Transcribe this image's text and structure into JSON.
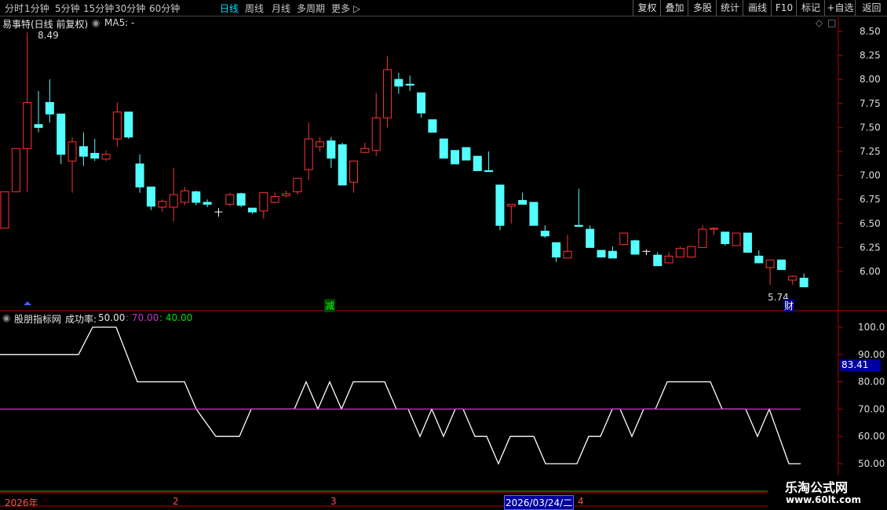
{
  "toolbar": {
    "left_items": [
      {
        "label": "分时",
        "active": false
      },
      {
        "label": "1分钟",
        "active": false
      },
      {
        "label": "5分钟",
        "active": false
      },
      {
        "label": "15分钟",
        "active": false
      },
      {
        "label": "30分钟",
        "active": false
      },
      {
        "label": "60分钟",
        "active": false
      },
      {
        "label": "日线",
        "active": true
      },
      {
        "label": "周线",
        "active": false
      },
      {
        "label": "月线",
        "active": false
      },
      {
        "label": "多周期",
        "active": false
      },
      {
        "label": "更多",
        "active": false
      }
    ],
    "right_items": [
      "复权",
      "叠加",
      "多股",
      "统计",
      "画线",
      "F10",
      "标记",
      "+自选",
      "返回"
    ]
  },
  "main_panel": {
    "title": "易事特(日线 前复权)",
    "ma_label": "MA5: -",
    "high_label": "8.49",
    "low_label": "5.74",
    "marker_jian": "减",
    "marker_cai": "财",
    "price_ticks": [
      "8.50",
      "8.25",
      "8.00",
      "7.75",
      "7.50",
      "7.25",
      "7.00",
      "6.75",
      "6.50",
      "6.25",
      "6.00"
    ]
  },
  "sub_panel": {
    "indicator_name": "股朋指标网",
    "field_label": "成功率:",
    "value": "50.00",
    "value2": "70.00",
    "value3": "40.00",
    "current_tag": "83.41",
    "ticks": [
      "100.0",
      "90.00",
      "80.00",
      "70.00",
      "60.00",
      "50.00"
    ]
  },
  "date_axis": {
    "year_label": "2026年",
    "month_labels": [
      "2",
      "3",
      "4"
    ],
    "cursor_date": "2026/03/24/二"
  },
  "watermark": {
    "title": "乐淘公式网",
    "url": "www.60lt.com"
  },
  "colors": {
    "up": "#ff3232",
    "down": "#54ffff",
    "cross": "#ffffff",
    "line_purple": "#c832c8",
    "axis": "#b40000"
  },
  "chart_data": [
    {
      "type": "candlestick",
      "title": "易事特(日线 前复权)",
      "ylim": [
        5.72,
        8.58
      ],
      "candles": [
        [
          6.45,
          6.83,
          6.83,
          6.45
        ],
        [
          6.83,
          7.28,
          7.28,
          6.83
        ],
        [
          7.28,
          7.76,
          8.49,
          6.83
        ],
        [
          7.53,
          7.5,
          7.88,
          7.45
        ],
        [
          7.76,
          7.64,
          8.0,
          7.55
        ],
        [
          7.64,
          7.22,
          7.64,
          7.12
        ],
        [
          7.15,
          7.35,
          7.4,
          6.82
        ],
        [
          7.3,
          7.2,
          7.45,
          7.1
        ],
        [
          7.23,
          7.18,
          7.38,
          7.15
        ],
        [
          7.17,
          7.22,
          7.26,
          7.15
        ],
        [
          7.38,
          7.66,
          7.76,
          7.3
        ],
        [
          7.66,
          7.4,
          7.66,
          7.38
        ],
        [
          7.12,
          6.88,
          7.22,
          6.82
        ],
        [
          6.88,
          6.68,
          6.88,
          6.64
        ],
        [
          6.67,
          6.73,
          6.75,
          6.62
        ],
        [
          6.67,
          6.8,
          7.08,
          6.52
        ],
        [
          6.72,
          6.84,
          6.88,
          6.69
        ],
        [
          6.83,
          6.72,
          6.84,
          6.69
        ],
        [
          6.72,
          6.7,
          6.75,
          6.67
        ],
        [
          6.62,
          6.62,
          6.66,
          6.57
        ],
        [
          6.7,
          6.8,
          6.82,
          6.68
        ],
        [
          6.81,
          6.69,
          6.82,
          6.67
        ],
        [
          6.66,
          6.62,
          6.66,
          6.6
        ],
        [
          6.63,
          6.82,
          6.82,
          6.55
        ],
        [
          6.72,
          6.78,
          6.82,
          6.71
        ],
        [
          6.79,
          6.81,
          6.84,
          6.77
        ],
        [
          6.83,
          6.97,
          6.97,
          6.8
        ],
        [
          7.06,
          7.38,
          7.55,
          6.95
        ],
        [
          7.3,
          7.35,
          7.4,
          7.25
        ],
        [
          7.36,
          7.18,
          7.4,
          7.08
        ],
        [
          7.32,
          6.9,
          7.34,
          6.9
        ],
        [
          6.93,
          7.15,
          7.15,
          6.82
        ],
        [
          7.24,
          7.28,
          7.34,
          7.23
        ],
        [
          7.26,
          7.6,
          7.86,
          7.2
        ],
        [
          7.6,
          8.1,
          8.24,
          7.5
        ],
        [
          8.0,
          7.93,
          8.07,
          7.85
        ],
        [
          7.95,
          7.94,
          8.04,
          7.88
        ],
        [
          7.86,
          7.65,
          7.86,
          7.6
        ],
        [
          7.58,
          7.45,
          7.58,
          7.45
        ],
        [
          7.38,
          7.18,
          7.38,
          7.18
        ],
        [
          7.26,
          7.12,
          7.26,
          7.12
        ],
        [
          7.29,
          7.16,
          7.29,
          7.16
        ],
        [
          7.2,
          7.05,
          7.2,
          7.05
        ],
        [
          7.05,
          7.04,
          7.25,
          7.04
        ],
        [
          6.9,
          6.48,
          6.9,
          6.43
        ],
        [
          6.68,
          6.7,
          6.7,
          6.5
        ],
        [
          6.74,
          6.7,
          6.82,
          6.7
        ],
        [
          6.72,
          6.48,
          6.72,
          6.48
        ],
        [
          6.42,
          6.37,
          6.48,
          6.35
        ],
        [
          6.3,
          6.15,
          6.3,
          6.1
        ],
        [
          6.14,
          6.21,
          6.38,
          6.14
        ],
        [
          6.48,
          6.47,
          6.86,
          6.47
        ],
        [
          6.44,
          6.25,
          6.48,
          6.25
        ],
        [
          6.22,
          6.15,
          6.22,
          6.15
        ],
        [
          6.21,
          6.14,
          6.26,
          6.14
        ],
        [
          6.28,
          6.4,
          6.4,
          6.27
        ],
        [
          6.32,
          6.18,
          6.33,
          6.18
        ],
        [
          6.21,
          6.21,
          6.23,
          6.17
        ],
        [
          6.17,
          6.06,
          6.2,
          6.06
        ],
        [
          6.09,
          6.16,
          6.2,
          6.09
        ],
        [
          6.15,
          6.24,
          6.26,
          6.15
        ],
        [
          6.15,
          6.26,
          6.26,
          6.14
        ],
        [
          6.25,
          6.44,
          6.48,
          6.25
        ],
        [
          6.44,
          6.45,
          6.46,
          6.38
        ],
        [
          6.41,
          6.29,
          6.41,
          6.27
        ],
        [
          6.27,
          6.4,
          6.4,
          6.27
        ],
        [
          6.4,
          6.2,
          6.4,
          6.2
        ],
        [
          6.16,
          6.09,
          6.22,
          6.09
        ],
        [
          6.04,
          6.12,
          6.12,
          5.86
        ],
        [
          6.12,
          6.02,
          6.12,
          6.02
        ],
        [
          5.91,
          5.95,
          5.96,
          5.86
        ],
        [
          5.93,
          5.84,
          5.98,
          5.84
        ]
      ]
    },
    {
      "type": "line",
      "title": "股朋指标网 成功率",
      "ylim": [
        47.5,
        102.5
      ],
      "series": [
        {
          "name": "成功率",
          "values": [
            [
              0,
              90
            ],
            [
              100,
              90
            ],
            [
              118,
              100
            ],
            [
              148,
              100
            ],
            [
              175,
              80
            ],
            [
              235,
              80
            ],
            [
              250,
              70
            ],
            [
              275,
              60
            ],
            [
              305,
              60
            ],
            [
              320,
              70
            ],
            [
              375,
              70
            ],
            [
              390,
              80
            ],
            [
              405,
              70
            ],
            [
              420,
              80
            ],
            [
              435,
              70
            ],
            [
              450,
              80
            ],
            [
              490,
              80
            ],
            [
              505,
              70
            ],
            [
              520,
              70
            ],
            [
              535,
              60
            ],
            [
              550,
              70
            ],
            [
              565,
              60
            ],
            [
              580,
              70
            ],
            [
              590,
              70
            ],
            [
              605,
              60
            ],
            [
              620,
              60
            ],
            [
              635,
              50
            ],
            [
              650,
              60
            ],
            [
              680,
              60
            ],
            [
              695,
              50
            ],
            [
              735,
              50
            ],
            [
              750,
              60
            ],
            [
              765,
              60
            ],
            [
              780,
              70
            ],
            [
              790,
              70
            ],
            [
              805,
              60
            ],
            [
              820,
              70
            ],
            [
              835,
              70
            ],
            [
              850,
              80
            ],
            [
              905,
              80
            ],
            [
              920,
              70
            ],
            [
              950,
              70
            ],
            [
              965,
              60
            ],
            [
              980,
              70
            ],
            [
              1005,
              50
            ],
            [
              1020,
              50
            ]
          ]
        },
        {
          "name": "70.00",
          "values": [
            [
              0,
              70
            ],
            [
              1020,
              70
            ]
          ]
        }
      ]
    }
  ]
}
